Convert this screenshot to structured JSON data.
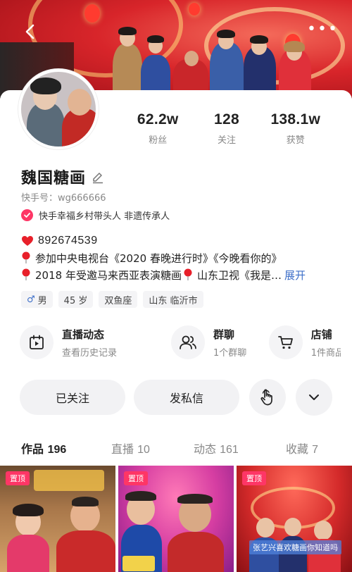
{
  "profile": {
    "name": "魏国糖画",
    "kuaishou_id": "快手号：wg666666",
    "certification": "快手幸福乡村带头人 非遗传承人"
  },
  "stats": [
    {
      "value": "62.2w",
      "label": "粉丝"
    },
    {
      "value": "128",
      "label": "关注"
    },
    {
      "value": "138.1w",
      "label": "获赞"
    }
  ],
  "bio": {
    "line1": "892674539",
    "line2": "参加中央电视台《2020 春晚进行时》《今晚看你的》",
    "line3": "2018 年受邀马来西亚表演糖画",
    "line3b": "山东卫视《我是…",
    "expand_label": "展开"
  },
  "tags": [
    "男",
    "45 岁",
    "双鱼座",
    "山东 临沂市"
  ],
  "features": [
    {
      "title": "直播动态",
      "subtitle": "查看历史记录",
      "icon": "calendar-icon"
    },
    {
      "title": "群聊",
      "subtitle": "1个群聊",
      "icon": "group-icon"
    },
    {
      "title": "店铺",
      "subtitle": "1件商品",
      "icon": "cart-icon"
    }
  ],
  "actions": {
    "follow_label": "已关注",
    "message_label": "发私信"
  },
  "tabs": [
    {
      "label": "作品",
      "count": "196"
    },
    {
      "label": "直播",
      "count": "10"
    },
    {
      "label": "动态",
      "count": "161"
    },
    {
      "label": "收藏",
      "count": "7"
    }
  ],
  "posts": [
    {
      "badge": "置顶"
    },
    {
      "badge": "置顶"
    },
    {
      "badge": "置顶",
      "caption": "张艺兴喜欢糖画你知道吗"
    }
  ],
  "colors": {
    "accent": "#fe3666",
    "link": "#3c6ec8",
    "banner_red": "#d8252a"
  }
}
